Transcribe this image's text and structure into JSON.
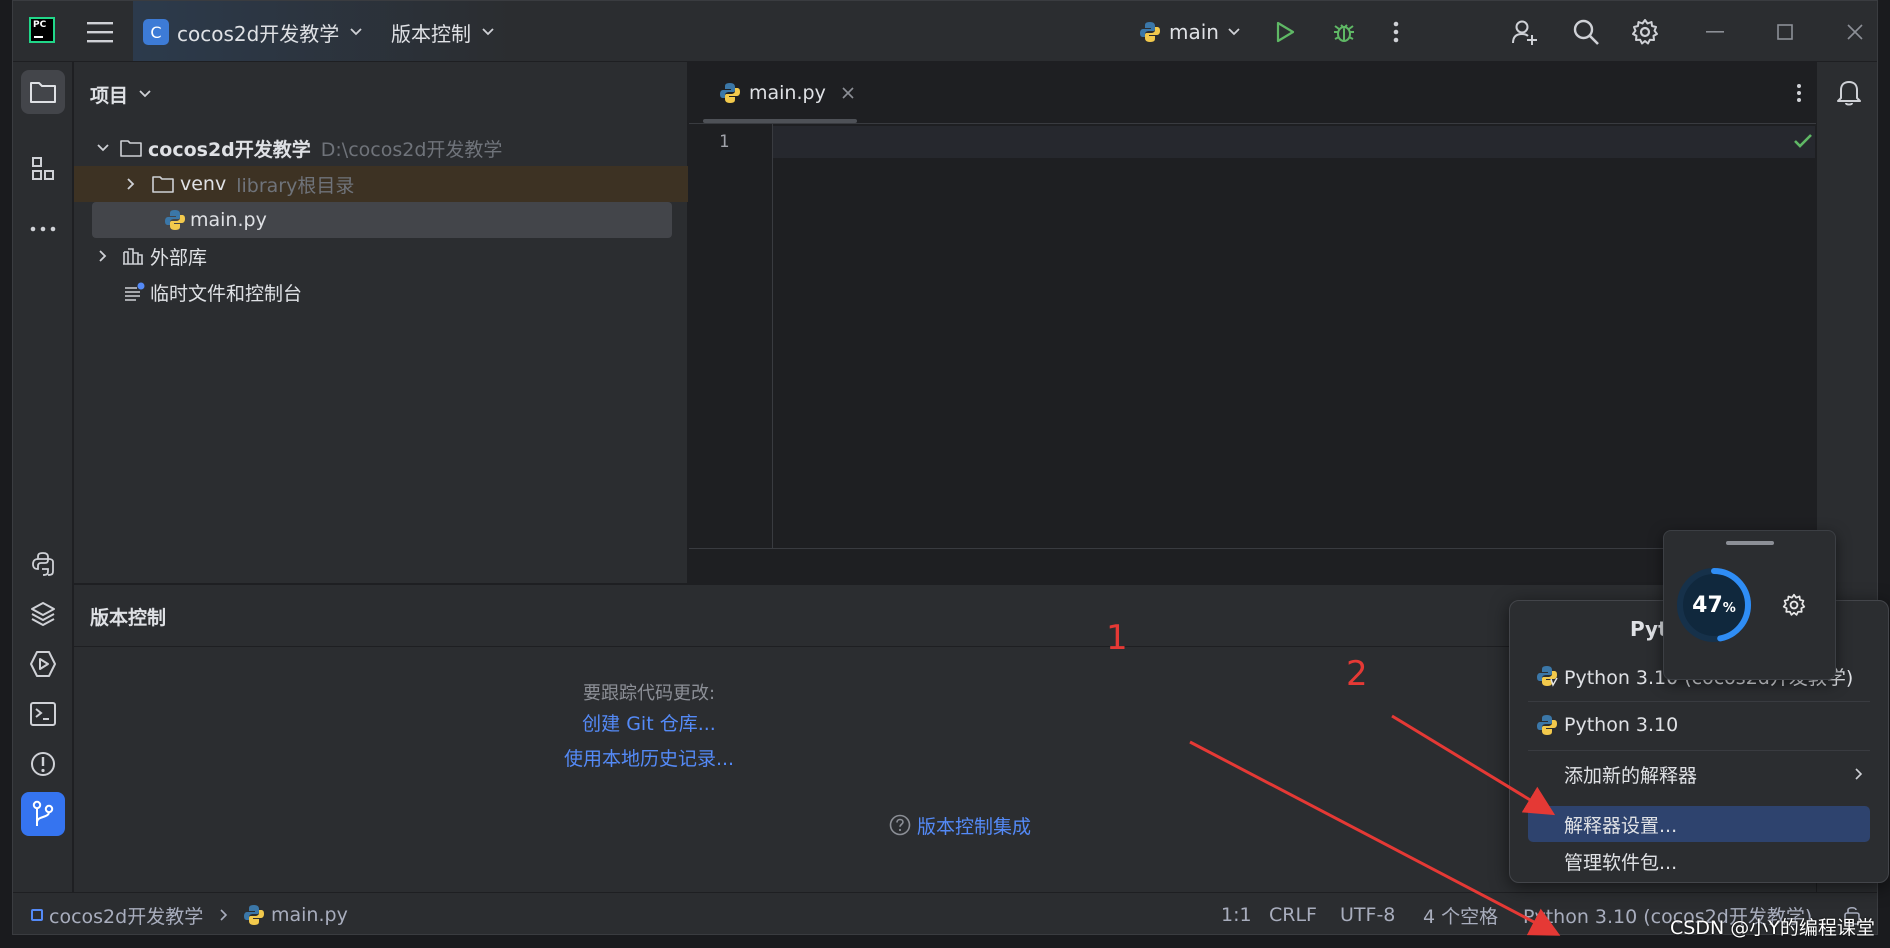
{
  "app": {
    "logo_text": "PC",
    "project_name": "cocos2d开发教学",
    "project_initial": "C",
    "vcs_menu": "版本控制",
    "run_config": "main"
  },
  "project_panel": {
    "title": "项目",
    "root_name": "cocos2d开发教学",
    "root_path": "D:\\cocos2d开发教学",
    "venv_name": "venv",
    "venv_hint": "library根目录",
    "main_file": "main.py",
    "external_libs": "外部库",
    "scratches": "临时文件和控制台"
  },
  "editor": {
    "tab_label": "main.py",
    "line_number": "1"
  },
  "vcs_panel": {
    "title": "版本控制",
    "hint": "要跟踪代码更改:",
    "create_git": "创建 Git 仓库...",
    "local_history": "使用本地历史记录...",
    "integration": "版本控制集成"
  },
  "popup": {
    "header_partial": "Pyt",
    "items": [
      {
        "label": "Python 3.10 (cocos2d开发教学)"
      },
      {
        "label": "Python 3.10"
      },
      {
        "label": "添加新的解释器"
      },
      {
        "label": "解释器设置..."
      },
      {
        "label": "管理软件包..."
      }
    ]
  },
  "widget": {
    "percent_number": "47",
    "percent_sign": "%",
    "level": 0.47
  },
  "statusbar": {
    "project": "cocos2d开发教学",
    "file": "main.py",
    "position": "1:1",
    "line_ending": "CRLF",
    "encoding": "UTF-8",
    "indent": "4 个空格",
    "interpreter": "Python 3.10 (cocos2d开发教学)"
  },
  "annotations": {
    "label_1": "1",
    "label_2": "2",
    "color": "#e53935"
  },
  "watermark": "CSDN @小Y的编程课堂",
  "colors": {
    "accent": "#3574f0",
    "link": "#548af7",
    "run_green": "#5fb865",
    "selection": "#2e436e",
    "venv_row": "#3d3223"
  }
}
